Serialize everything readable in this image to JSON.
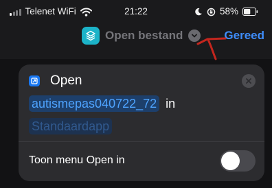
{
  "status_bar": {
    "carrier": "Telenet WiFi",
    "time": "21:22",
    "battery": "58%",
    "signal_bars_active": 1,
    "battery_level": 0.58
  },
  "nav": {
    "title": "Open bestand",
    "done_label": "Gereed"
  },
  "action": {
    "title": "Open",
    "file_name": "autismepas040722_72",
    "in_label": "in",
    "app_placeholder": "Standaardapp"
  },
  "toggle": {
    "label": "Toon menu Open in",
    "on": false
  },
  "colors": {
    "accent": "#3f8efc",
    "app_icon": "#1cb3c8",
    "annotation_arrow": "#c4261e"
  },
  "icons": {
    "signal": "cellular-signal-icon",
    "wifi": "wifi-icon",
    "moon": "do-not-disturb-icon",
    "rotation_lock": "rotation-lock-icon",
    "battery": "battery-icon",
    "app": "shortcuts-layers-icon",
    "chevron": "chevron-down-icon",
    "action": "open-app-icon",
    "close": "close-icon"
  }
}
